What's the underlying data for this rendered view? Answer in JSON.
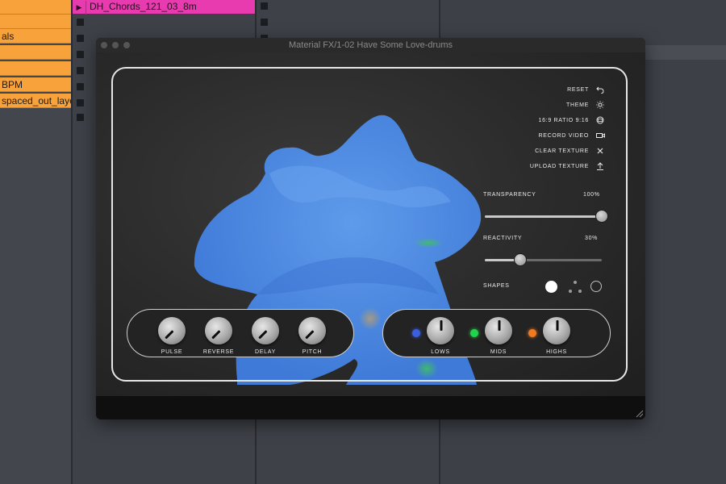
{
  "daw": {
    "left_clips": [
      "",
      "",
      "als",
      "",
      "",
      "BPM",
      "spaced_out_laye"
    ],
    "top_clip": "DH_Chords_121_03_8m"
  },
  "window": {
    "title": "Material FX/1-02 Have Some Love-drums"
  },
  "menu": [
    {
      "label": "RESET",
      "icon": "undo-icon"
    },
    {
      "label": "THEME",
      "icon": "sun-icon"
    },
    {
      "label": "16:9 RATIO 9:16",
      "icon": "aspect-ratio-icon"
    },
    {
      "label": "RECORD VIDEO",
      "icon": "video-camera-icon"
    },
    {
      "label": "CLEAR TEXTURE",
      "icon": "close-icon"
    },
    {
      "label": "UPLOAD TEXTURE",
      "icon": "upload-icon"
    }
  ],
  "sliders": {
    "transparency": {
      "label": "TRANSPARENCY",
      "value_text": "100%",
      "value": 1.0
    },
    "reactivity": {
      "label": "REACTIVITY",
      "value_text": "30%",
      "value": 0.3
    }
  },
  "shapes": {
    "label": "SHAPES"
  },
  "knobs_left": [
    {
      "label": "PULSE"
    },
    {
      "label": "REVERSE"
    },
    {
      "label": "DELAY"
    },
    {
      "label": "PITCH"
    }
  ],
  "knobs_right": [
    {
      "label": "LOWS",
      "led_color": "#3b5fe0"
    },
    {
      "label": "MIDS",
      "led_color": "#22d44a"
    },
    {
      "label": "HIGHS",
      "led_color": "#f07a22"
    }
  ],
  "colors": {
    "blob": "#4f8ce0",
    "pink_clip": "#e93bb0",
    "orange_clip": "#f7a23a"
  }
}
